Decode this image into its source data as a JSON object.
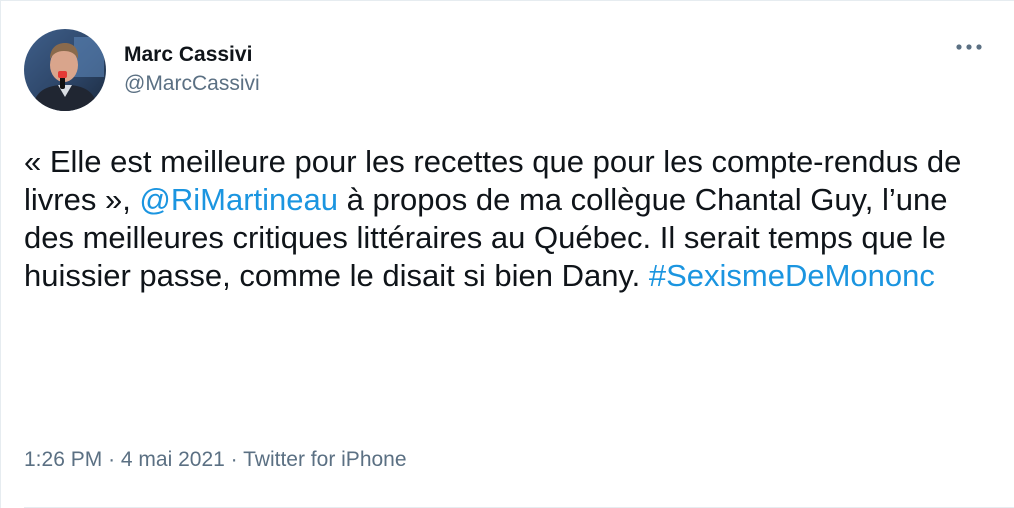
{
  "user": {
    "display_name": "Marc Cassivi",
    "handle": "@MarcCassivi"
  },
  "tweet": {
    "text_part1": "« Elle est meilleure pour les recettes que pour les compte-rendus de livres », ",
    "mention": "@RiMartineau",
    "text_part2": " à propos de ma collègue Chantal Guy, l’une des meilleures critiques littéraires au Québec. Il serait temps que le huissier passe, comme le disait si bien Dany. ",
    "hashtag": "#SexismeDeMononc"
  },
  "meta": {
    "time": "1:26 PM",
    "separator": "·",
    "date": "4 mai 2021",
    "source": "Twitter for iPhone"
  },
  "icons": {
    "more": "more-horizontal-icon",
    "avatar": "profile-photo"
  },
  "colors": {
    "link": "#1b95e0",
    "text": "#0f1419",
    "secondary": "#5b7083"
  }
}
